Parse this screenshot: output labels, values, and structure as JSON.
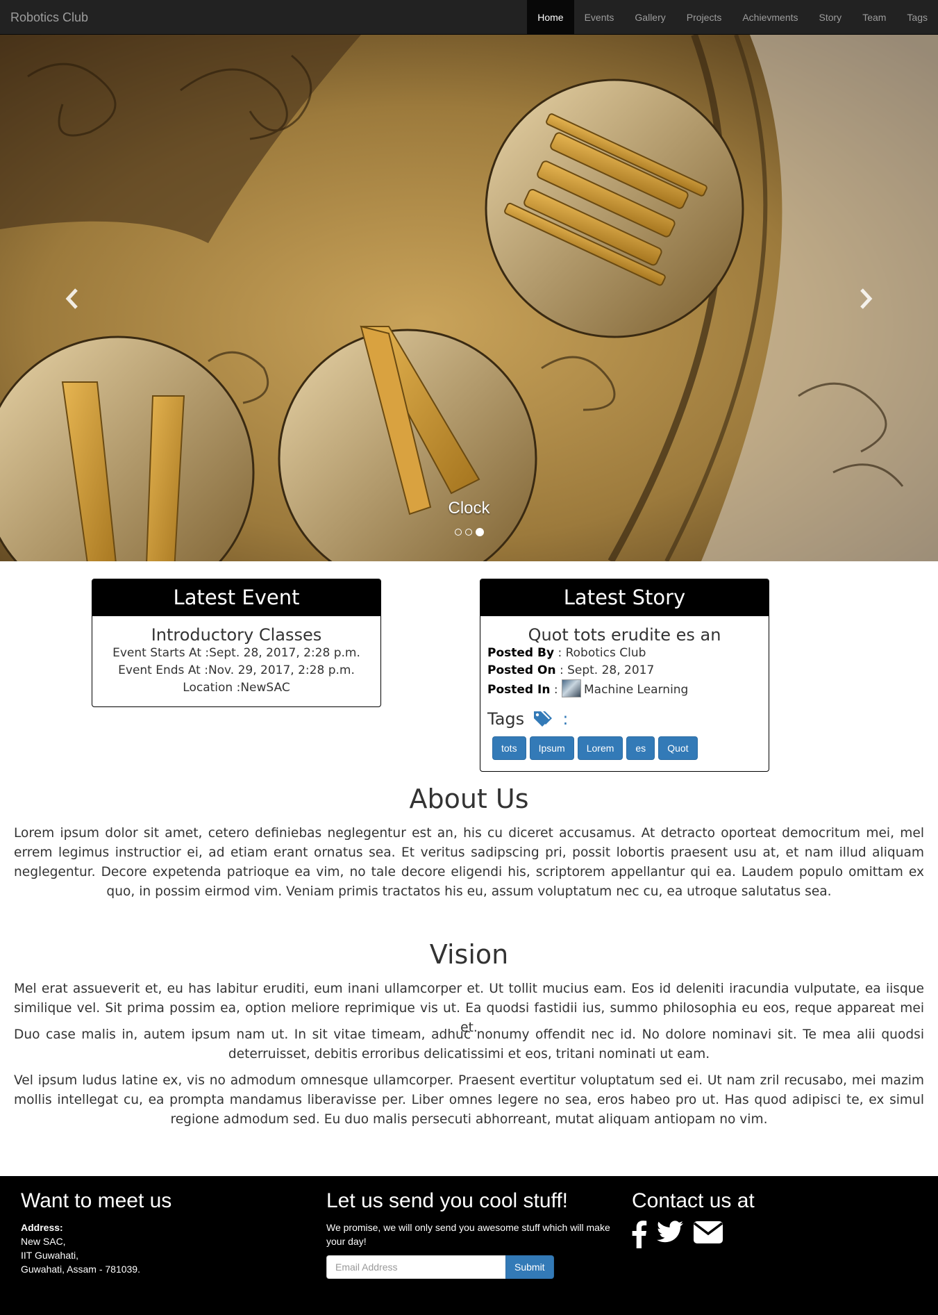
{
  "navbar": {
    "brand": "Robotics Club",
    "items": [
      {
        "label": "Home",
        "active": true
      },
      {
        "label": "Events"
      },
      {
        "label": "Gallery"
      },
      {
        "label": "Projects"
      },
      {
        "label": "Achievments"
      },
      {
        "label": "Story"
      },
      {
        "label": "Team"
      },
      {
        "label": "Tags"
      }
    ]
  },
  "carousel": {
    "caption": "Clock",
    "slide_count": 3,
    "active_slide": 3,
    "prev_icon": "chevron-left-icon",
    "next_icon": "chevron-right-icon"
  },
  "latest_event": {
    "heading": "Latest Event",
    "title": "Introductory Classes",
    "starts": "Event Starts At :Sept. 28, 2017, 2:28 p.m.",
    "ends": "Event Ends At :Nov. 29, 2017, 2:28 p.m.",
    "location": "Location :NewSAC"
  },
  "latest_story": {
    "heading": "Latest Story",
    "title": "Quot tots erudite es an",
    "posted_by_label": "Posted By",
    "posted_by": " : Robotics Club",
    "posted_on_label": "Posted On",
    "posted_on": " : Sept. 28, 2017",
    "posted_in_label": "Posted In",
    "posted_in_sep": " : ",
    "posted_in": "Machine Learning",
    "tags_label": "Tags",
    "tags_colon": ":",
    "tags": [
      "tots",
      "Ipsum",
      "Lorem",
      "es",
      "Quot"
    ]
  },
  "about": {
    "title": "About Us",
    "text": "Lorem ipsum dolor sit amet, cetero definiebas neglegentur est an, his cu diceret accusamus. At detracto oporteat democritum mei, mel errem legimus instructior ei, ad etiam erant ornatus sea. Et veritus sadipscing pri, possit lobortis praesent usu at, et nam illud aliquam neglegentur. Decore expetenda patrioque ea vim, no tale decore eligendi his, scriptorem appellantur qui ea. Laudem populo omittam ex quo, in possim eirmod vim. Veniam primis tractatos his eu, assum voluptatum nec cu, ea utroque salutatus sea."
  },
  "vision": {
    "title": "Vision",
    "p1": "Mel erat assueverit et, eu has labitur eruditi, eum inani ullamcorper et. Ut tollit mucius eam. Eos id deleniti iracundia vulputate, ea iisque similique vel. Sit prima possim ea, option meliore reprimique vis ut. Ea quodsi fastidii ius, summo philosophia eu eos, reque appareat mei et.",
    "p2": "Duo case malis in, autem ipsum nam ut. In sit vitae timeam, adhuc nonumy offendit nec id. No dolore nominavi sit. Te mea alii quodsi deterruisset, debitis erroribus delicatissimi et eos, tritani nominati ut eam.",
    "p3": "Vel ipsum ludus latine ex, vis no admodum omnesque ullamcorper. Praesent evertitur voluptatum sed ei. Ut nam zril recusabo, mei mazim mollis intellegat cu, ea prompta mandamus liberavisse per. Liber omnes legere no sea, eros habeo pro ut. Has quod adipisci te, ex simul regione admodum sed. Eu duo malis persecuti abhorreant, mutat aliquam antiopam no vim."
  },
  "footer": {
    "meet_title": "Want to meet us",
    "address_label": "Address:",
    "address_lines": [
      "New SAC,",
      "IIT Guwahati,",
      "Guwahati, Assam - 781039."
    ],
    "newsletter_title": "Let us send you cool stuff!",
    "newsletter_text": "We promise, we will only send you awesome stuff which will make your day!",
    "email_placeholder": "Email Address",
    "submit_label": "Submit",
    "contact_title": "Contact us at",
    "social_icons": [
      "facebook-icon",
      "twitter-icon",
      "envelope-icon"
    ]
  },
  "colors": {
    "navbar_bg": "#222222",
    "primary_button": "#337ab7",
    "footer_bg": "#000000",
    "card_header_bg": "#000000"
  }
}
